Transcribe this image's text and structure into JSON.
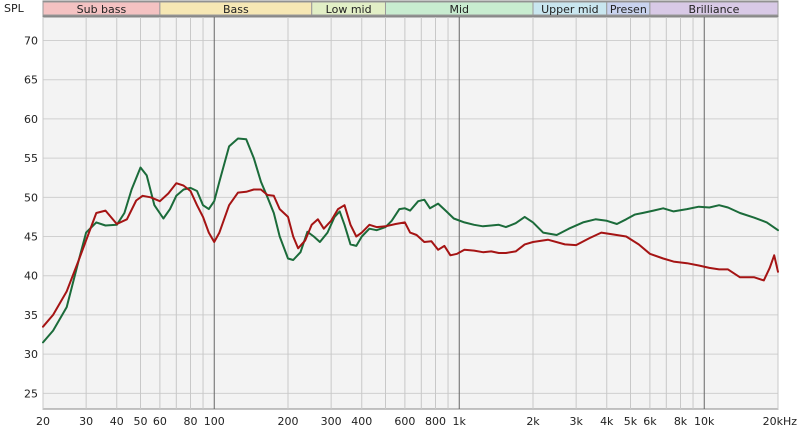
{
  "chart_data": {
    "type": "line",
    "ylabel": "SPL",
    "xlabel": "",
    "x_scale": "log",
    "xlim": [
      20,
      20000
    ],
    "ylim": [
      23,
      73
    ],
    "grid": true,
    "y_ticks": [
      25,
      30,
      35,
      40,
      45,
      50,
      55,
      60,
      65,
      70
    ],
    "x_ticks": [
      {
        "v": 20,
        "label": "20"
      },
      {
        "v": 30,
        "label": "30"
      },
      {
        "v": 40,
        "label": "40"
      },
      {
        "v": 50,
        "label": "50"
      },
      {
        "v": 60,
        "label": "60"
      },
      {
        "v": 80,
        "label": "80"
      },
      {
        "v": 100,
        "label": "100"
      },
      {
        "v": 200,
        "label": "200"
      },
      {
        "v": 300,
        "label": "300"
      },
      {
        "v": 400,
        "label": "400"
      },
      {
        "v": 600,
        "label": "600"
      },
      {
        "v": 800,
        "label": "800"
      },
      {
        "v": 1000,
        "label": "1k"
      },
      {
        "v": 2000,
        "label": "2k"
      },
      {
        "v": 3000,
        "label": "3k"
      },
      {
        "v": 4000,
        "label": "4k"
      },
      {
        "v": 5000,
        "label": "5k"
      },
      {
        "v": 6000,
        "label": "6k"
      },
      {
        "v": 8000,
        "label": "8k"
      },
      {
        "v": 10000,
        "label": "10k"
      },
      {
        "v": 20000,
        "label": "20kHz"
      }
    ],
    "bands": [
      {
        "label": "Sub bass",
        "from": 20,
        "to": 60,
        "color": "#f4c2c2"
      },
      {
        "label": "Bass",
        "from": 60,
        "to": 250,
        "color": "#f6e7b4"
      },
      {
        "label": "Low mid",
        "from": 250,
        "to": 500,
        "color": "#e2efc6"
      },
      {
        "label": "Mid",
        "from": 500,
        "to": 2000,
        "color": "#c8ecd0"
      },
      {
        "label": "Upper mid",
        "from": 2000,
        "to": 4000,
        "color": "#c9e6ef"
      },
      {
        "label": "Presen",
        "from": 4000,
        "to": 6000,
        "color": "#c9d3ef"
      },
      {
        "label": "Brilliance",
        "from": 6000,
        "to": 20000,
        "color": "#d8c9e6"
      }
    ],
    "series": [
      {
        "color": "#1b6b3a",
        "points": [
          [
            20,
            31.5
          ],
          [
            22,
            33
          ],
          [
            25,
            36
          ],
          [
            28,
            42
          ],
          [
            30,
            45.5
          ],
          [
            33,
            46.8
          ],
          [
            36,
            46.4
          ],
          [
            40,
            46.5
          ],
          [
            43,
            48
          ],
          [
            46,
            51
          ],
          [
            50,
            53.8
          ],
          [
            53,
            52.8
          ],
          [
            57,
            49
          ],
          [
            62,
            47.3
          ],
          [
            66,
            48.5
          ],
          [
            70,
            50.2
          ],
          [
            75,
            51
          ],
          [
            80,
            51.2
          ],
          [
            85,
            50.8
          ],
          [
            90,
            49
          ],
          [
            95,
            48.5
          ],
          [
            100,
            49.5
          ],
          [
            105,
            52
          ],
          [
            115,
            56.5
          ],
          [
            125,
            57.5
          ],
          [
            135,
            57.4
          ],
          [
            145,
            55
          ],
          [
            155,
            52
          ],
          [
            165,
            50
          ],
          [
            175,
            48
          ],
          [
            185,
            45
          ],
          [
            200,
            42.2
          ],
          [
            210,
            42
          ],
          [
            225,
            43
          ],
          [
            240,
            45.6
          ],
          [
            255,
            45
          ],
          [
            270,
            44.3
          ],
          [
            290,
            45.5
          ],
          [
            310,
            47.5
          ],
          [
            325,
            48.2
          ],
          [
            340,
            46.5
          ],
          [
            360,
            44
          ],
          [
            380,
            43.8
          ],
          [
            400,
            45
          ],
          [
            430,
            46
          ],
          [
            460,
            45.8
          ],
          [
            500,
            46.2
          ],
          [
            530,
            47
          ],
          [
            570,
            48.5
          ],
          [
            600,
            48.6
          ],
          [
            630,
            48.3
          ],
          [
            680,
            49.5
          ],
          [
            720,
            49.7
          ],
          [
            760,
            48.6
          ],
          [
            820,
            49.2
          ],
          [
            880,
            48.3
          ],
          [
            950,
            47.3
          ],
          [
            1050,
            46.8
          ],
          [
            1150,
            46.5
          ],
          [
            1250,
            46.3
          ],
          [
            1350,
            46.4
          ],
          [
            1450,
            46.5
          ],
          [
            1550,
            46.2
          ],
          [
            1700,
            46.7
          ],
          [
            1850,
            47.5
          ],
          [
            2000,
            46.8
          ],
          [
            2200,
            45.5
          ],
          [
            2500,
            45.2
          ],
          [
            2800,
            46
          ],
          [
            3200,
            46.8
          ],
          [
            3600,
            47.2
          ],
          [
            4000,
            47
          ],
          [
            4400,
            46.6
          ],
          [
            4800,
            47.2
          ],
          [
            5200,
            47.8
          ],
          [
            5600,
            48
          ],
          [
            6200,
            48.3
          ],
          [
            6800,
            48.6
          ],
          [
            7500,
            48.2
          ],
          [
            8500,
            48.5
          ],
          [
            9500,
            48.8
          ],
          [
            10500,
            48.7
          ],
          [
            11500,
            49
          ],
          [
            12500,
            48.7
          ],
          [
            14000,
            48
          ],
          [
            16000,
            47.4
          ],
          [
            18000,
            46.8
          ],
          [
            20000,
            45.8
          ]
        ]
      },
      {
        "color": "#a51414",
        "points": [
          [
            20,
            33.5
          ],
          [
            22,
            35
          ],
          [
            25,
            38
          ],
          [
            28,
            42
          ],
          [
            30,
            44.5
          ],
          [
            33,
            48
          ],
          [
            36,
            48.3
          ],
          [
            40,
            46.6
          ],
          [
            44,
            47.2
          ],
          [
            48,
            49.6
          ],
          [
            51,
            50.2
          ],
          [
            55,
            50
          ],
          [
            60,
            49.5
          ],
          [
            65,
            50.5
          ],
          [
            70,
            51.8
          ],
          [
            75,
            51.5
          ],
          [
            80,
            50.8
          ],
          [
            85,
            49
          ],
          [
            90,
            47.5
          ],
          [
            95,
            45.5
          ],
          [
            100,
            44.3
          ],
          [
            105,
            45.5
          ],
          [
            115,
            49
          ],
          [
            125,
            50.6
          ],
          [
            135,
            50.7
          ],
          [
            145,
            51
          ],
          [
            155,
            51
          ],
          [
            165,
            50.3
          ],
          [
            175,
            50.2
          ],
          [
            185,
            48.5
          ],
          [
            200,
            47.5
          ],
          [
            210,
            45
          ],
          [
            220,
            43.5
          ],
          [
            235,
            44.5
          ],
          [
            250,
            46.5
          ],
          [
            265,
            47.2
          ],
          [
            280,
            46
          ],
          [
            300,
            47
          ],
          [
            320,
            48.5
          ],
          [
            340,
            49
          ],
          [
            360,
            46.5
          ],
          [
            380,
            45
          ],
          [
            400,
            45.5
          ],
          [
            430,
            46.5
          ],
          [
            460,
            46.2
          ],
          [
            500,
            46.3
          ],
          [
            550,
            46.6
          ],
          [
            600,
            46.8
          ],
          [
            630,
            45.5
          ],
          [
            670,
            45.2
          ],
          [
            720,
            44.3
          ],
          [
            770,
            44.4
          ],
          [
            820,
            43.3
          ],
          [
            870,
            43.8
          ],
          [
            920,
            42.6
          ],
          [
            980,
            42.8
          ],
          [
            1050,
            43.3
          ],
          [
            1150,
            43.2
          ],
          [
            1250,
            43
          ],
          [
            1350,
            43.1
          ],
          [
            1450,
            42.9
          ],
          [
            1550,
            42.9
          ],
          [
            1700,
            43.1
          ],
          [
            1850,
            44
          ],
          [
            2000,
            44.3
          ],
          [
            2300,
            44.6
          ],
          [
            2700,
            44
          ],
          [
            3000,
            43.9
          ],
          [
            3400,
            44.8
          ],
          [
            3800,
            45.5
          ],
          [
            4200,
            45.3
          ],
          [
            4800,
            45
          ],
          [
            5400,
            44
          ],
          [
            6000,
            42.8
          ],
          [
            6800,
            42.2
          ],
          [
            7500,
            41.8
          ],
          [
            8500,
            41.6
          ],
          [
            9500,
            41.3
          ],
          [
            10500,
            41
          ],
          [
            11500,
            40.8
          ],
          [
            12500,
            40.8
          ],
          [
            14000,
            39.8
          ],
          [
            16000,
            39.8
          ],
          [
            17500,
            39.4
          ],
          [
            18500,
            41
          ],
          [
            19300,
            42.6
          ],
          [
            20000,
            40.5
          ]
        ]
      }
    ]
  }
}
